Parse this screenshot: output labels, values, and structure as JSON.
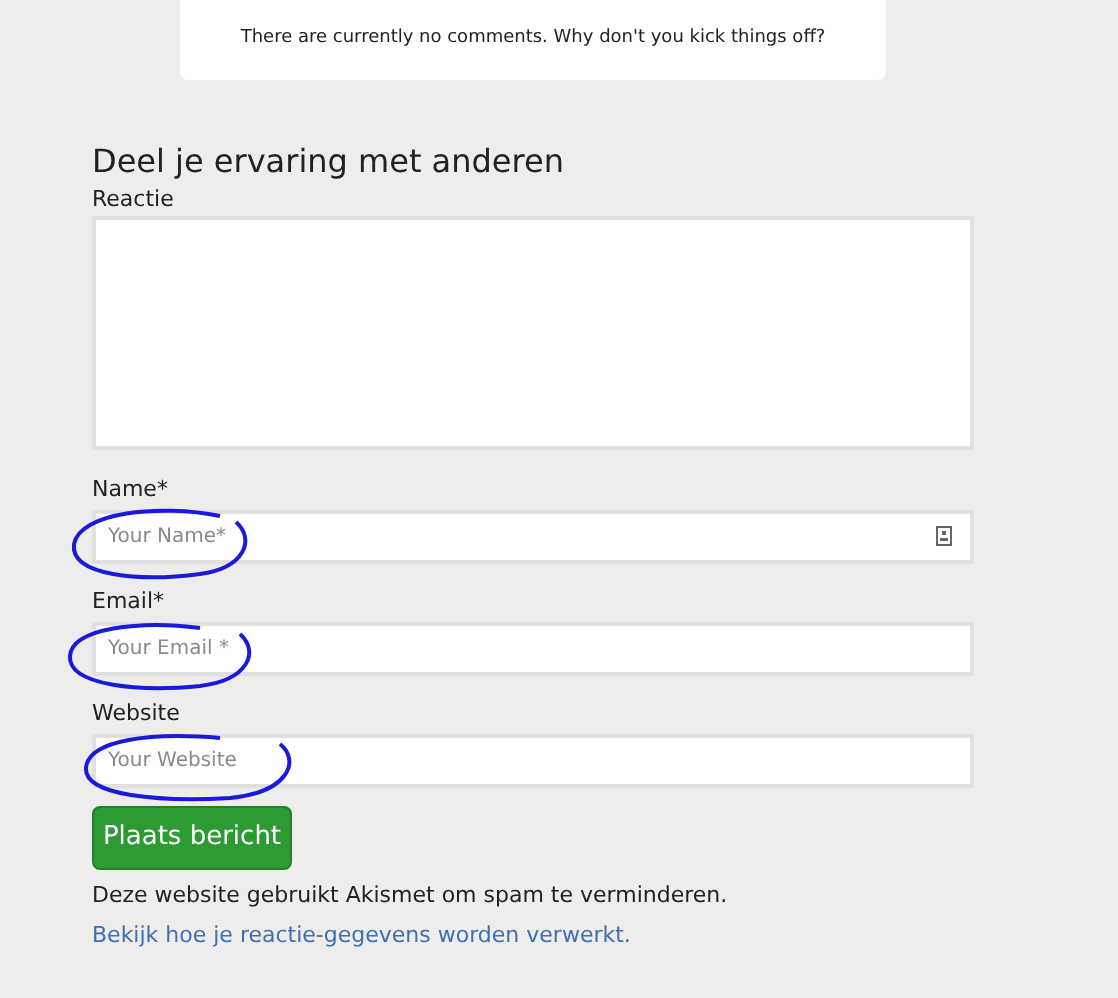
{
  "comments_notice": "There are currently no comments. Why don't you kick things off?",
  "form": {
    "heading": "Deel je ervaring met anderen",
    "fields": [
      {
        "kind": "textarea",
        "label": "Reactie"
      },
      {
        "kind": "text",
        "label": "Name*",
        "placeholder": "Your Name*",
        "contact_icon": true
      },
      {
        "kind": "text",
        "label": "Email*",
        "placeholder": "Your Email *",
        "contact_icon": false
      },
      {
        "kind": "text",
        "label": "Website",
        "placeholder": "Your Website",
        "contact_icon": false
      }
    ],
    "submit": "Plaats bericht",
    "notice": "Deze website gebruikt Akismet om spam te verminderen.",
    "notice_link": "Bekijk hoe je reactie-gegevens worden verwerkt."
  }
}
